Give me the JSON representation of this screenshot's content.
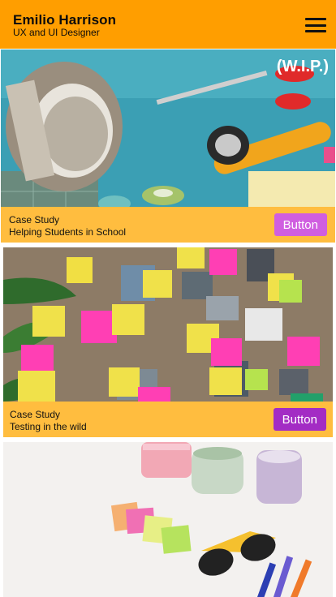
{
  "header": {
    "name": "Emilio Harrison",
    "role": "UX and UI Designer",
    "background": "#ff9e00",
    "menu_icon": "hamburger-menu-icon"
  },
  "cards": [
    {
      "badge": "(W.I.P.)",
      "label": "Case Study",
      "title": "Helping Students in School",
      "button": "Button",
      "button_color": "#d05ee0",
      "bar_color": "#ffbd3f"
    },
    {
      "label": "Case Study",
      "title": "Testing in the wild",
      "button": "Button",
      "button_color": "#a32cc4",
      "bar_color": "#ffbd3f"
    },
    {
      "label": "",
      "title": ""
    }
  ]
}
